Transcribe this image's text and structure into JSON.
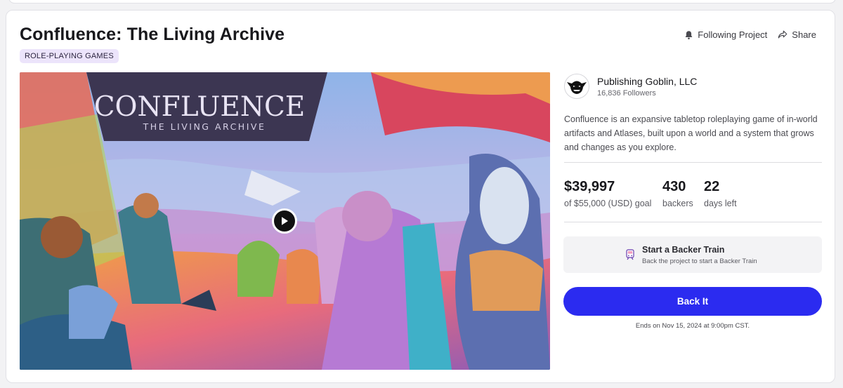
{
  "project": {
    "title": "Confluence: The Living Archive",
    "category": "ROLE-PLAYING GAMES",
    "media_logo_line1": "CONFLUENCE",
    "media_logo_line2": "THE LIVING ARCHIVE",
    "media_play_icon": "play-icon"
  },
  "actions": {
    "follow_label": "Following Project",
    "follow_icon": "bell-icon",
    "share_label": "Share",
    "share_icon": "share-arrow-icon"
  },
  "creator": {
    "name": "Publishing Goblin, LLC",
    "followers": "16,836 Followers",
    "avatar_icon": "goblin-logo"
  },
  "description": "Confluence is an expansive tabletop roleplaying game of in-world artifacts and Atlases, built upon a world and a system that grows and changes as you explore.",
  "stats": {
    "pledged": "$39,997",
    "goal": "of $55,000 (USD) goal",
    "backers_count": "430",
    "backers_label": "backers",
    "days_count": "22",
    "days_label": "days left"
  },
  "backer_train": {
    "title": "Start a Backer Train",
    "subtitle": "Back the project to start a Backer Train",
    "icon": "train-icon"
  },
  "cta": {
    "back_label": "Back It",
    "ends_text": "Ends on Nov 15, 2024 at 9:00pm CST."
  },
  "colors": {
    "accent": "#2b2bf0",
    "category_bg": "#ece4fb"
  }
}
